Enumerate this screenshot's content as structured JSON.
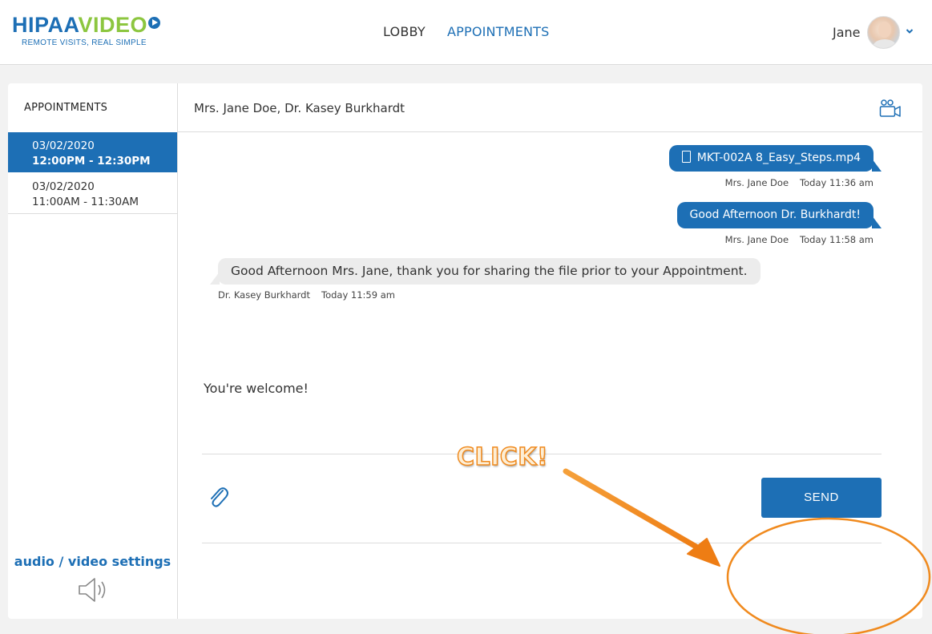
{
  "logo": {
    "part1": "HIPAA",
    "part2": "VIDEO",
    "tagline": "REMOTE VISITS, REAL SIMPLE"
  },
  "nav": {
    "lobby": "LOBBY",
    "appointments": "APPOINTMENTS"
  },
  "user": {
    "name": "Jane"
  },
  "sidebar": {
    "title": "APPOINTMENTS",
    "appointments": [
      {
        "date": "03/02/2020",
        "time": "12:00PM - 12:30PM",
        "selected": true
      },
      {
        "date": "03/02/2020",
        "time": "11:00AM - 11:30AM",
        "selected": false
      }
    ],
    "settings_label": "audio / video settings"
  },
  "chat": {
    "title": "Mrs. Jane Doe, Dr. Kasey Burkhardt",
    "messages": [
      {
        "text": "MKT-002A 8_Easy_Steps.mp4",
        "sender": "Mrs. Jane Doe",
        "time": "Today 11:36 am",
        "direction": "outgoing",
        "is_file": true
      },
      {
        "text": "Good Afternoon Dr. Burkhardt!",
        "sender": "Mrs. Jane Doe",
        "time": "Today 11:58 am",
        "direction": "outgoing",
        "is_file": false
      },
      {
        "text": "Good Afternoon Mrs. Jane, thank you for sharing the file prior to your Appointment.",
        "sender": "Dr. Kasey Burkhardt",
        "time": "Today 11:59 am",
        "direction": "incoming",
        "is_file": false
      }
    ],
    "compose_value": "You're welcome!",
    "send_label": "SEND"
  },
  "annotation": {
    "label": "CLICK!",
    "color": "#f08a1e"
  },
  "colors": {
    "brand_blue": "#1d6fb5",
    "brand_green": "#8cc63f"
  }
}
